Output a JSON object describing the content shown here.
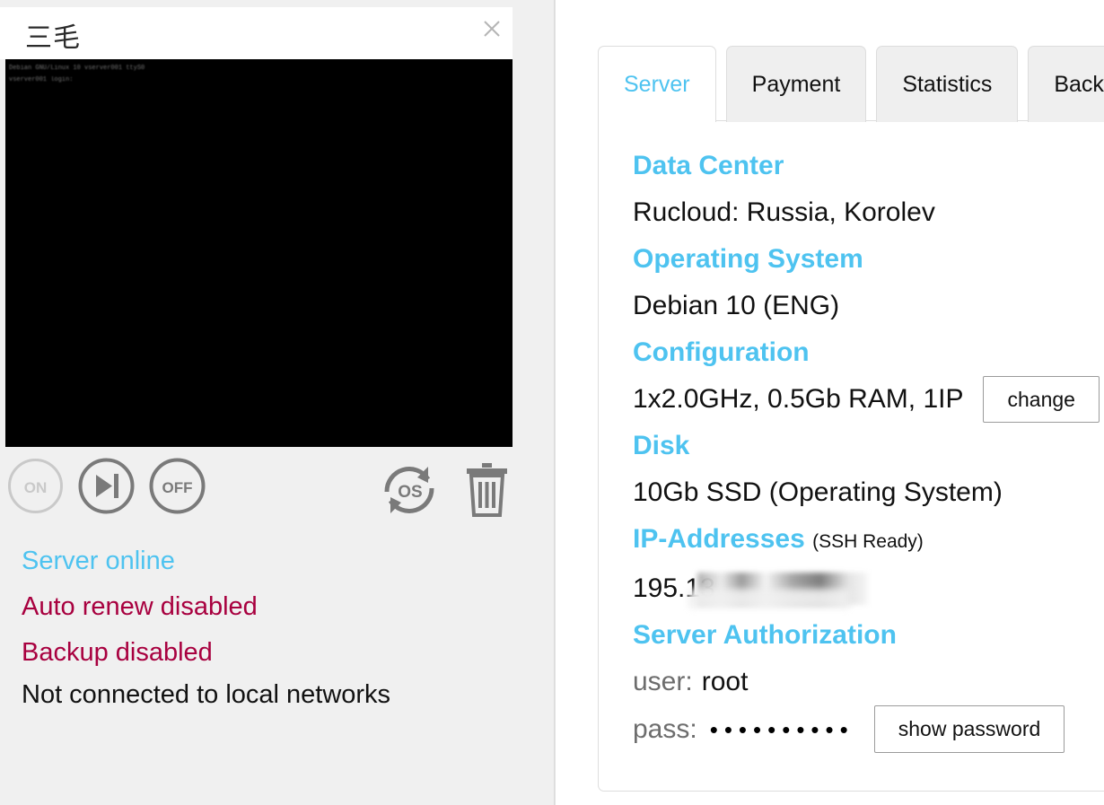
{
  "console": {
    "title": "三毛",
    "close_label": "×",
    "terminal_lines": [
      "Debian GNU/Linux 10 vserver001 ttyS0",
      "vserver001 login:",
      ""
    ],
    "controls": [
      {
        "name": "power-on",
        "label": "ON",
        "state": "disabled"
      },
      {
        "name": "restart",
        "label": "restart",
        "state": "enabled"
      },
      {
        "name": "power-off",
        "label": "OFF",
        "state": "enabled"
      },
      {
        "name": "reinstall-os",
        "label": "OS",
        "state": "enabled"
      },
      {
        "name": "delete-server",
        "label": "delete",
        "state": "enabled"
      }
    ],
    "status": {
      "server": "Server online",
      "auto_renew": "Auto renew disabled",
      "backup": "Backup disabled",
      "network": "Not connected to local networks"
    }
  },
  "tabs": [
    {
      "label": "Server",
      "active": true
    },
    {
      "label": "Payment",
      "active": false
    },
    {
      "label": "Statistics",
      "active": false
    },
    {
      "label": "Backup",
      "active": false
    }
  ],
  "server": {
    "data_center": {
      "label": "Data Center",
      "value": "Rucloud: Russia, Korolev"
    },
    "operating_system": {
      "label": "Operating System",
      "value": "Debian 10 (ENG)"
    },
    "configuration": {
      "label": "Configuration",
      "value": "1x2.0GHz, 0.5Gb RAM, 1IP",
      "button": "change"
    },
    "disk": {
      "label": "Disk",
      "value": "10Gb SSD (Operating System)"
    },
    "ip_addresses": {
      "label": "IP-Addresses",
      "sub": "(SSH Ready)",
      "value": "195.13"
    },
    "authorization": {
      "label": "Server Authorization",
      "user_label": "user:",
      "user_value": "root",
      "pass_label": "pass:",
      "pass_masked": "••••••••••",
      "pass_button": "show password"
    }
  },
  "colors": {
    "accent": "#4ec3f0",
    "warning": "#a8003f",
    "text": "#111111",
    "panel_bg": "#f0f0f0",
    "terminal_bg": "#000000"
  }
}
